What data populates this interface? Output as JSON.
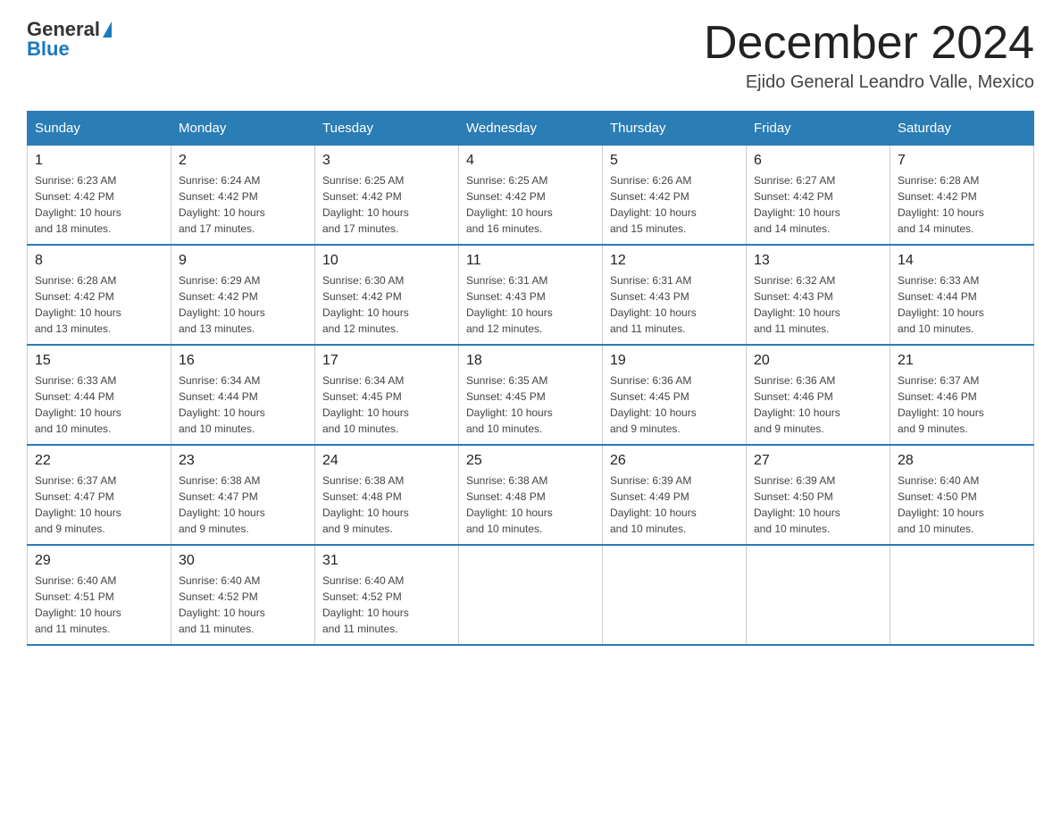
{
  "header": {
    "logo_general": "General",
    "logo_blue": "Blue",
    "month_title": "December 2024",
    "location": "Ejido General Leandro Valle, Mexico"
  },
  "days_of_week": [
    "Sunday",
    "Monday",
    "Tuesday",
    "Wednesday",
    "Thursday",
    "Friday",
    "Saturday"
  ],
  "weeks": [
    [
      {
        "day": "1",
        "sunrise": "6:23 AM",
        "sunset": "4:42 PM",
        "daylight": "10 hours and 18 minutes."
      },
      {
        "day": "2",
        "sunrise": "6:24 AM",
        "sunset": "4:42 PM",
        "daylight": "10 hours and 17 minutes."
      },
      {
        "day": "3",
        "sunrise": "6:25 AM",
        "sunset": "4:42 PM",
        "daylight": "10 hours and 17 minutes."
      },
      {
        "day": "4",
        "sunrise": "6:25 AM",
        "sunset": "4:42 PM",
        "daylight": "10 hours and 16 minutes."
      },
      {
        "day": "5",
        "sunrise": "6:26 AM",
        "sunset": "4:42 PM",
        "daylight": "10 hours and 15 minutes."
      },
      {
        "day": "6",
        "sunrise": "6:27 AM",
        "sunset": "4:42 PM",
        "daylight": "10 hours and 14 minutes."
      },
      {
        "day": "7",
        "sunrise": "6:28 AM",
        "sunset": "4:42 PM",
        "daylight": "10 hours and 14 minutes."
      }
    ],
    [
      {
        "day": "8",
        "sunrise": "6:28 AM",
        "sunset": "4:42 PM",
        "daylight": "10 hours and 13 minutes."
      },
      {
        "day": "9",
        "sunrise": "6:29 AM",
        "sunset": "4:42 PM",
        "daylight": "10 hours and 13 minutes."
      },
      {
        "day": "10",
        "sunrise": "6:30 AM",
        "sunset": "4:42 PM",
        "daylight": "10 hours and 12 minutes."
      },
      {
        "day": "11",
        "sunrise": "6:31 AM",
        "sunset": "4:43 PM",
        "daylight": "10 hours and 12 minutes."
      },
      {
        "day": "12",
        "sunrise": "6:31 AM",
        "sunset": "4:43 PM",
        "daylight": "10 hours and 11 minutes."
      },
      {
        "day": "13",
        "sunrise": "6:32 AM",
        "sunset": "4:43 PM",
        "daylight": "10 hours and 11 minutes."
      },
      {
        "day": "14",
        "sunrise": "6:33 AM",
        "sunset": "4:44 PM",
        "daylight": "10 hours and 10 minutes."
      }
    ],
    [
      {
        "day": "15",
        "sunrise": "6:33 AM",
        "sunset": "4:44 PM",
        "daylight": "10 hours and 10 minutes."
      },
      {
        "day": "16",
        "sunrise": "6:34 AM",
        "sunset": "4:44 PM",
        "daylight": "10 hours and 10 minutes."
      },
      {
        "day": "17",
        "sunrise": "6:34 AM",
        "sunset": "4:45 PM",
        "daylight": "10 hours and 10 minutes."
      },
      {
        "day": "18",
        "sunrise": "6:35 AM",
        "sunset": "4:45 PM",
        "daylight": "10 hours and 10 minutes."
      },
      {
        "day": "19",
        "sunrise": "6:36 AM",
        "sunset": "4:45 PM",
        "daylight": "10 hours and 9 minutes."
      },
      {
        "day": "20",
        "sunrise": "6:36 AM",
        "sunset": "4:46 PM",
        "daylight": "10 hours and 9 minutes."
      },
      {
        "day": "21",
        "sunrise": "6:37 AM",
        "sunset": "4:46 PM",
        "daylight": "10 hours and 9 minutes."
      }
    ],
    [
      {
        "day": "22",
        "sunrise": "6:37 AM",
        "sunset": "4:47 PM",
        "daylight": "10 hours and 9 minutes."
      },
      {
        "day": "23",
        "sunrise": "6:38 AM",
        "sunset": "4:47 PM",
        "daylight": "10 hours and 9 minutes."
      },
      {
        "day": "24",
        "sunrise": "6:38 AM",
        "sunset": "4:48 PM",
        "daylight": "10 hours and 9 minutes."
      },
      {
        "day": "25",
        "sunrise": "6:38 AM",
        "sunset": "4:48 PM",
        "daylight": "10 hours and 10 minutes."
      },
      {
        "day": "26",
        "sunrise": "6:39 AM",
        "sunset": "4:49 PM",
        "daylight": "10 hours and 10 minutes."
      },
      {
        "day": "27",
        "sunrise": "6:39 AM",
        "sunset": "4:50 PM",
        "daylight": "10 hours and 10 minutes."
      },
      {
        "day": "28",
        "sunrise": "6:40 AM",
        "sunset": "4:50 PM",
        "daylight": "10 hours and 10 minutes."
      }
    ],
    [
      {
        "day": "29",
        "sunrise": "6:40 AM",
        "sunset": "4:51 PM",
        "daylight": "10 hours and 11 minutes."
      },
      {
        "day": "30",
        "sunrise": "6:40 AM",
        "sunset": "4:52 PM",
        "daylight": "10 hours and 11 minutes."
      },
      {
        "day": "31",
        "sunrise": "6:40 AM",
        "sunset": "4:52 PM",
        "daylight": "10 hours and 11 minutes."
      },
      null,
      null,
      null,
      null
    ]
  ],
  "labels": {
    "sunrise": "Sunrise:",
    "sunset": "Sunset:",
    "daylight": "Daylight:"
  }
}
